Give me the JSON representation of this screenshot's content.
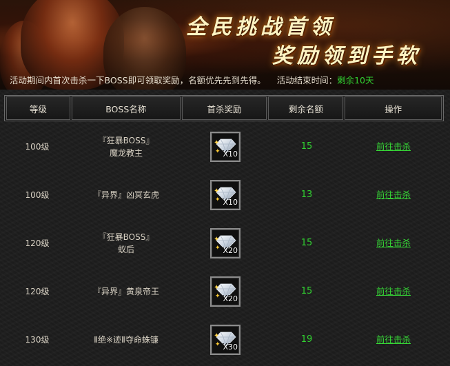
{
  "banner": {
    "title_line1": "全民挑战首领",
    "title_line2": "奖励领到手软",
    "notice": "活动期间内首次击杀一下BOSS即可领取奖励，名额优先先到先得。",
    "end_label": "活动结束时间：",
    "remain": "剩余10天"
  },
  "table": {
    "headers": [
      "等级",
      "BOSS名称",
      "首杀奖励",
      "剩余名额",
      "操作"
    ],
    "rows": [
      {
        "level": "100级",
        "name_line1": "『狂暴BOSS』",
        "name_line2": "魔龙教主",
        "reward_qty": "X10",
        "remaining": "15",
        "action": "前往击杀"
      },
      {
        "level": "100级",
        "name_line1": "『异界』凶冥玄虎",
        "name_line2": "",
        "reward_qty": "X10",
        "remaining": "13",
        "action": "前往击杀"
      },
      {
        "level": "120级",
        "name_line1": "『狂暴BOSS』",
        "name_line2": "蚁后",
        "reward_qty": "X20",
        "remaining": "15",
        "action": "前往击杀"
      },
      {
        "level": "120级",
        "name_line1": "『异界』黄泉帝王",
        "name_line2": "",
        "reward_qty": "X20",
        "remaining": "15",
        "action": "前往击杀"
      },
      {
        "level": "130级",
        "name_line1": "Ⅱ绝※迹Ⅱ夺命蛛镰",
        "name_line2": "",
        "reward_qty": "X30",
        "remaining": "19",
        "action": "前往击杀"
      }
    ]
  },
  "icons": {
    "reward": "diamond-icon",
    "sparkle": "sparkle-icon"
  },
  "colors": {
    "accent_green": "#31d331",
    "title_glow": "#ff9a2a"
  }
}
